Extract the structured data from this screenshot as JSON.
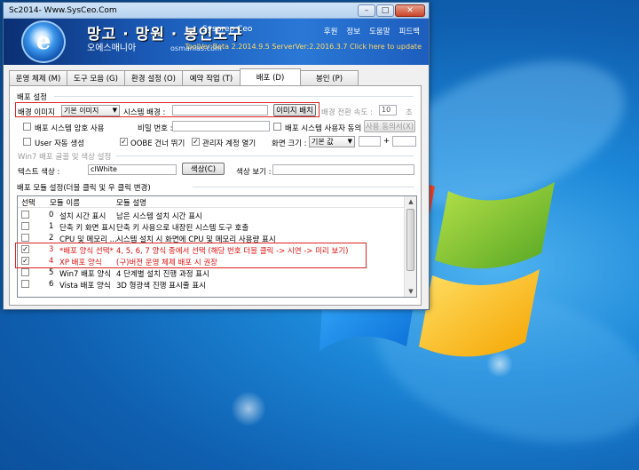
{
  "window": {
    "title": "Sc2014- Www.SysCeo.Com",
    "controls": [
      "–",
      "□",
      "✕"
    ]
  },
  "banner": {
    "title": "망고 · 망원 · 봉인도구",
    "subtitle": "Sysprep Ceo",
    "korean_name": "오에스매니아",
    "url": "osmanias.com",
    "menu": [
      "후원",
      "정보",
      "도움말",
      "피드백"
    ],
    "version": "ToolVer:Beta 2.2014.9.5 ServerVer:2.2016.3.7 Click here to update"
  },
  "tabs": [
    {
      "label": "운영 체제 (M)",
      "active": false
    },
    {
      "label": "도구 모음 (G)",
      "active": false
    },
    {
      "label": "환경 설정 (O)",
      "active": false
    },
    {
      "label": "예약 작업 (T)",
      "active": false
    },
    {
      "label": "배포 (D)",
      "active": true
    },
    {
      "label": "봉인 (P)",
      "active": false
    }
  ],
  "deploy": {
    "section_title": "배포 설정",
    "bg_image_label": "배경 이미지",
    "bg_image_value": "기본 이미지",
    "system_bg_label": "시스템 배경 :",
    "system_bg_value": "",
    "apply_image_button": "이미지 배치",
    "transition_label": "배경 전환 속도 :",
    "transition_value": "10",
    "transition_unit": "초",
    "password_check_label": "배포 시스템 암호 사용",
    "password_label": "비밀 번호 :",
    "password_value": "",
    "user_agree_label": "배포 시스템 사용자 동의",
    "user_agree_button": "사용 동의서(X)",
    "user_auto_label": "User 자동 생성",
    "oobe_skip_label": "OOBE 건너 뛰기",
    "oobe_skip_checked": true,
    "admin_open_label": "관리자 계정 열기",
    "admin_open_checked": true,
    "screen_size_label": "화면 크기 :",
    "screen_size_value": "기본 값",
    "screen_size_plus": "+",
    "win7_font_label": "Win7 배포 글꼴 및 색상 설정",
    "text_color_label": "텍스트 색상 :",
    "text_color_value": "clWhite",
    "color_button": "색상(C)",
    "color_preview_label": "색상 보기 :"
  },
  "module_list": {
    "section_title": "배포 모듈 설정(더블 클릭 및 우 클릭 변경)",
    "headers": [
      "선택",
      "모듈 이름",
      "모듈 설명"
    ],
    "rows": [
      {
        "checked": false,
        "num": "0",
        "name": "설치 시간 표시",
        "desc": "남은 시스템 설치 시간 표시",
        "red": false
      },
      {
        "checked": false,
        "num": "1",
        "name": "단축 키 화면 표시",
        "desc": "단축 키 사용으로 내장된 시스템 도구 호출",
        "red": false
      },
      {
        "checked": false,
        "num": "2",
        "name": "CPU 및 메모리 ...",
        "desc": "시스템 설치 시 화면에 CPU 및 메모리 사용량 표시",
        "red": false
      },
      {
        "checked": true,
        "num": "3",
        "name": "*배포 양식 선택*",
        "desc": "4, 5, 6, 7 양식 중에서 선택 (해당 번호 더블 클릭 -> 시연 -> 미리 보기)",
        "red": true
      },
      {
        "checked": true,
        "num": "4",
        "name": "XP 배포 양식",
        "desc": "(구)버전 운영 체제 배포 시 권장",
        "red": true
      },
      {
        "checked": false,
        "num": "5",
        "name": "Win7 배포 양식",
        "desc": "4 단계별 설치 진행 과정 표시",
        "red": false
      },
      {
        "checked": false,
        "num": "6",
        "name": "Vista 배포 양식",
        "desc": "3D 형광색 진행 표시줄 표시",
        "red": false
      }
    ]
  }
}
